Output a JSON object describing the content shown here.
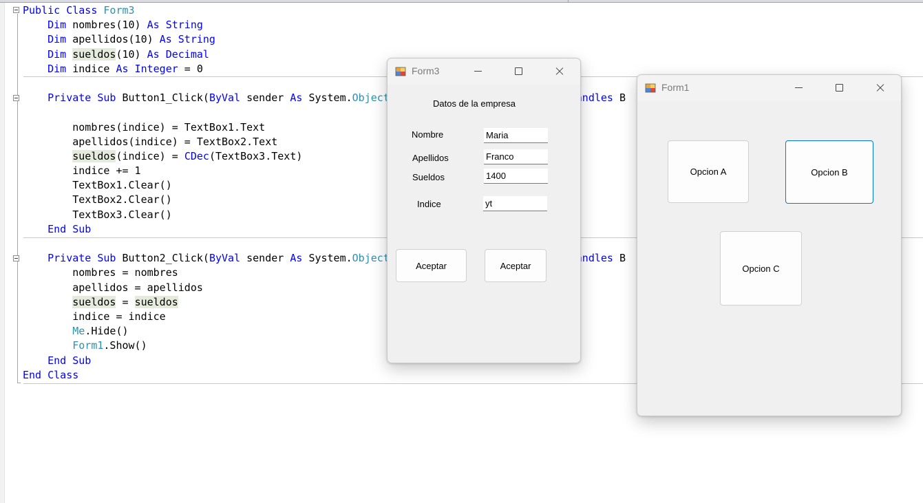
{
  "editor": {
    "lines": [
      {
        "ind": 0,
        "parts": [
          [
            "kw",
            "Public Class "
          ],
          [
            "ty",
            "Form3"
          ]
        ]
      },
      {
        "ind": 1,
        "parts": [
          [
            "kw",
            "Dim "
          ],
          [
            "",
            "nombres(10) "
          ],
          [
            "kw",
            "As String"
          ]
        ]
      },
      {
        "ind": 1,
        "parts": [
          [
            "kw",
            "Dim "
          ],
          [
            "",
            "apellidos(10) "
          ],
          [
            "kw",
            "As String"
          ]
        ]
      },
      {
        "ind": 1,
        "parts": [
          [
            "kw",
            "Dim "
          ],
          [
            "hl",
            "sueldos"
          ],
          [
            "",
            "(10) "
          ],
          [
            "kw",
            "As Decimal"
          ]
        ]
      },
      {
        "ind": 1,
        "parts": [
          [
            "kw",
            "Dim "
          ],
          [
            "",
            "indice "
          ],
          [
            "kw",
            "As Integer"
          ],
          [
            "",
            " = 0"
          ]
        ]
      },
      {
        "ind": 0,
        "parts": []
      },
      {
        "ind": 1,
        "parts": [
          [
            "kw",
            "Private Sub "
          ],
          [
            "",
            "Button1_Click("
          ],
          [
            "kw",
            "ByVal "
          ],
          [
            "",
            "sender "
          ],
          [
            "kw",
            "As "
          ],
          [
            "",
            "System."
          ],
          [
            "ty",
            "Object"
          ],
          [
            "",
            "                             "
          ],
          [
            "kw",
            "Handles "
          ],
          [
            "",
            "B"
          ]
        ]
      },
      {
        "ind": 0,
        "parts": []
      },
      {
        "ind": 2,
        "parts": [
          [
            "",
            "nombres(indice) = TextBox1.Text"
          ]
        ]
      },
      {
        "ind": 2,
        "parts": [
          [
            "",
            "apellidos(indice) = TextBox2.Text"
          ]
        ]
      },
      {
        "ind": 2,
        "parts": [
          [
            "hl",
            "sueldos"
          ],
          [
            "",
            "(indice) = "
          ],
          [
            "kw",
            "CDec"
          ],
          [
            "",
            "(TextBox3.Text)"
          ]
        ]
      },
      {
        "ind": 2,
        "parts": [
          [
            "",
            "indice += 1"
          ]
        ]
      },
      {
        "ind": 2,
        "parts": [
          [
            "",
            "TextBox1.Clear()"
          ]
        ]
      },
      {
        "ind": 2,
        "parts": [
          [
            "",
            "TextBox2.Clear()"
          ]
        ]
      },
      {
        "ind": 2,
        "parts": [
          [
            "",
            "TextBox3.Clear()"
          ]
        ]
      },
      {
        "ind": 1,
        "parts": [
          [
            "kw",
            "End Sub"
          ]
        ]
      },
      {
        "ind": 0,
        "parts": []
      },
      {
        "ind": 1,
        "parts": [
          [
            "kw",
            "Private Sub "
          ],
          [
            "",
            "Button2_Click("
          ],
          [
            "kw",
            "ByVal "
          ],
          [
            "",
            "sender "
          ],
          [
            "kw",
            "As "
          ],
          [
            "",
            "System."
          ],
          [
            "ty",
            "Object"
          ],
          [
            "",
            "                             "
          ],
          [
            "kw",
            "Handles "
          ],
          [
            "",
            "B"
          ]
        ]
      },
      {
        "ind": 2,
        "parts": [
          [
            "",
            "nombres = nombres"
          ]
        ]
      },
      {
        "ind": 2,
        "parts": [
          [
            "",
            "apellidos = apellidos"
          ]
        ]
      },
      {
        "ind": 2,
        "parts": [
          [
            "hl",
            "sueldos"
          ],
          [
            "",
            " = "
          ],
          [
            "hl",
            "sueldos"
          ]
        ]
      },
      {
        "ind": 2,
        "parts": [
          [
            "",
            "indice = indice"
          ]
        ]
      },
      {
        "ind": 2,
        "parts": [
          [
            "ty",
            "Me"
          ],
          [
            "",
            ".Hide()"
          ]
        ]
      },
      {
        "ind": 2,
        "parts": [
          [
            "ty",
            "Form1"
          ],
          [
            "",
            ".Show()"
          ]
        ]
      },
      {
        "ind": 1,
        "parts": [
          [
            "kw",
            "End Sub"
          ]
        ]
      },
      {
        "ind": 0,
        "parts": [
          [
            "kw",
            "End Class"
          ]
        ]
      }
    ]
  },
  "form3": {
    "title": "Form3",
    "heading": "Datos de la empresa",
    "fields": {
      "nombre": {
        "label": "Nombre",
        "value": "Maria"
      },
      "apellidos": {
        "label": "Apellidos",
        "value": "Franco"
      },
      "sueldos": {
        "label": "Sueldos",
        "value": "1400"
      },
      "indice": {
        "label": "Indice",
        "value": "yt"
      }
    },
    "button1_label": "Aceptar",
    "button2_label": "Aceptar"
  },
  "form1": {
    "title": "Form1",
    "option_a": "Opcion A",
    "option_b": "Opcion B",
    "option_c": "Opcion C"
  },
  "colors": {
    "keyword": "#0000ff",
    "type": "#2b91af",
    "highlight": "#e5ebdc",
    "focus_border": "#0078d4"
  }
}
